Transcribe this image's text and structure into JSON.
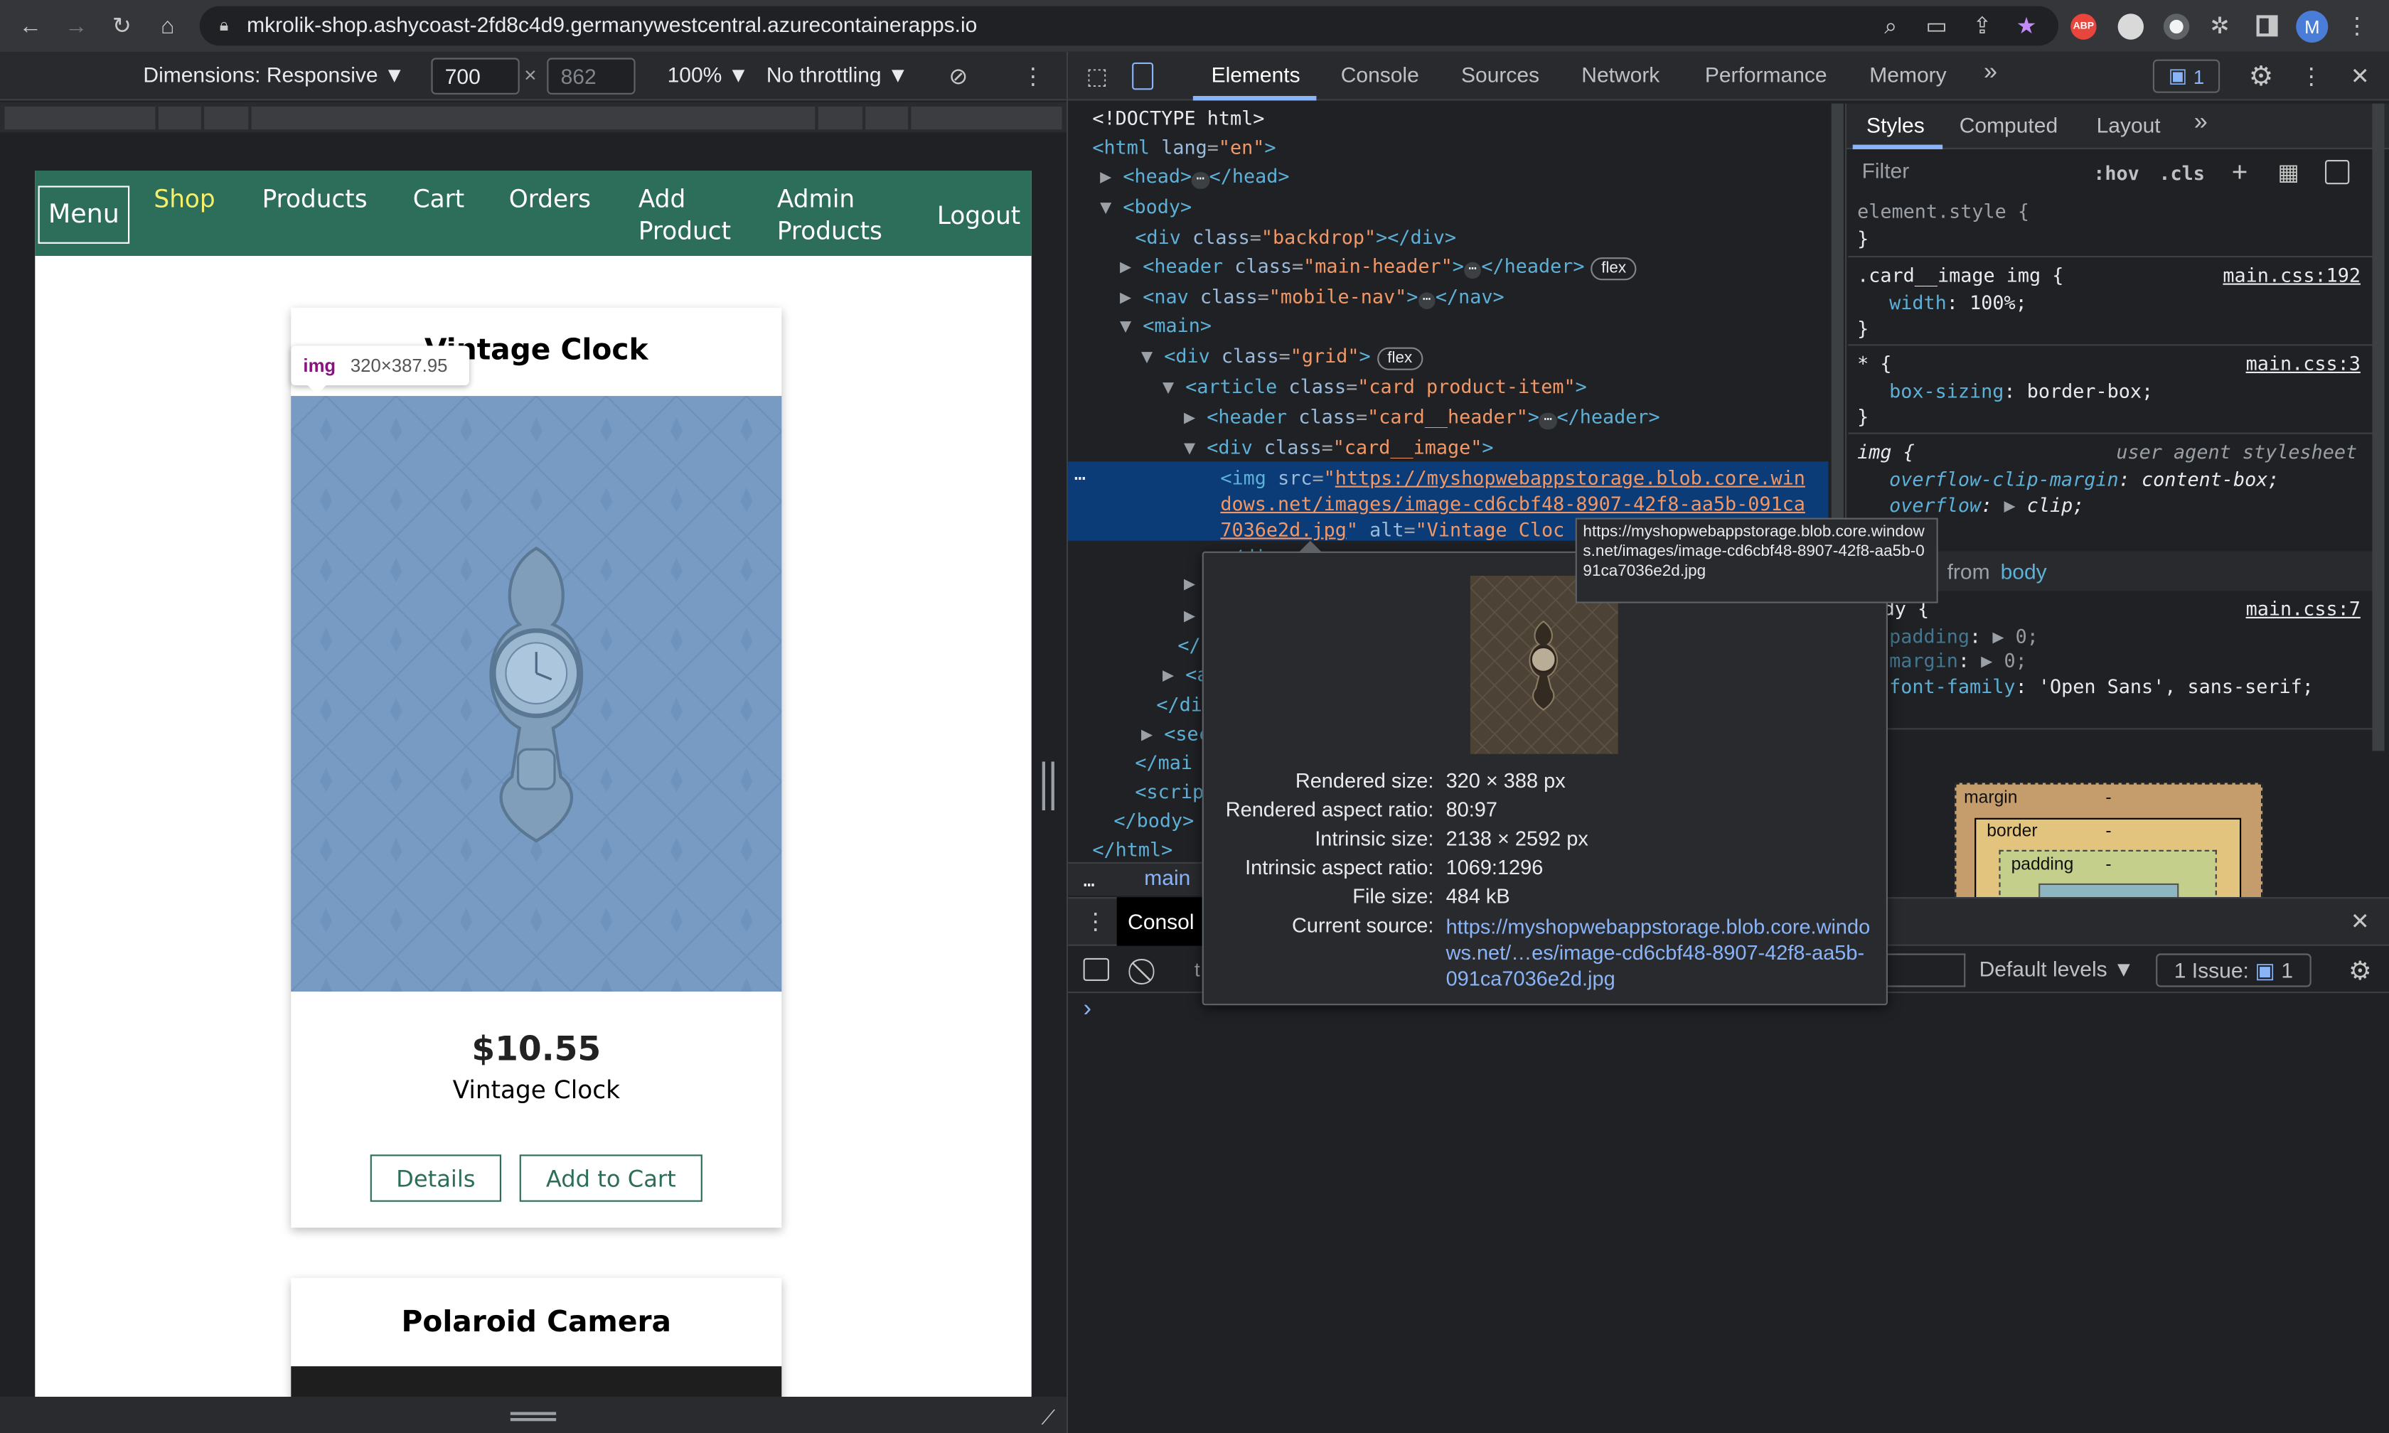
{
  "browser": {
    "url": "mkrolik-shop.ashycoast-2fd8c4d9.germanywestcentral.azurecontainerapps.io",
    "profile_initial": "M",
    "abp_label": "ABP"
  },
  "device_toolbar": {
    "dimensions_label": "Dimensions: Responsive",
    "width_value": "700",
    "height_placeholder": "862",
    "times": "×",
    "zoom": "100%",
    "throttling": "No throttling"
  },
  "shop": {
    "nav": {
      "menu": "Menu",
      "shop": "Shop",
      "products": "Products",
      "cart": "Cart",
      "orders": "Orders",
      "add_product_1": "Add",
      "add_product_2": "Product",
      "admin_products_1": "Admin",
      "admin_products_2": "Products",
      "logout": "Logout",
      "active_color": "#f6ef6b",
      "bar_color": "#2c6e5a"
    },
    "card1": {
      "title": "Vintage Clock",
      "price": "$10.55",
      "name": "Vintage Clock",
      "details_button": "Details",
      "add_to_cart_button": "Add to Cart"
    },
    "card2": {
      "title": "Polaroid Camera"
    },
    "img_tooltip": {
      "tag": "img",
      "size": "320×387.95"
    }
  },
  "devtools": {
    "tabs": [
      "Elements",
      "Console",
      "Sources",
      "Network",
      "Performance",
      "Memory"
    ],
    "more_tabs": "»",
    "issues_count": "1",
    "dom": {
      "doctype": "<!DOCTYPE html>",
      "html_open": "<html",
      "lang_attr": "lang",
      "lang_val": "\"en\"",
      "head": "<head>",
      "head_close": "</head>",
      "body_open": "<body>",
      "backdrop_div": "<div",
      "class_attr": "class",
      "backdrop_val": "\"backdrop\"",
      "div_close": "></div>",
      "header_tag": "<header",
      "main_header_val": "\"main-header\"",
      "header_close": "</header>",
      "flex": "flex",
      "nav_tag": "<nav",
      "mobile_nav_val": "\"mobile-nav\"",
      "nav_close": "</nav>",
      "main_open": "<main>",
      "grid_val": "\"grid\"",
      "article_tag": "<article",
      "article_val": "\"card product-item\"",
      "card_header_val": "\"card__header\"",
      "card_image_val": "\"card__image\"",
      "img_tag": "<img",
      "src_attr": "src",
      "src_line1": "https://myshopwebappstorage.blob.core.win",
      "src_line2": "dows.net/images/image-cd6cbf48-8907-42f8-aa5b-091ca",
      "src_line3": "7036e2d.jpg",
      "alt_attr": "alt",
      "alt_val": "\"Vintage Cloc",
      "div_end": "</div>",
      "a_frag": "<a",
      "di_frag": "</di",
      "sec_frag": "<sec",
      "main_frag": "</mai",
      "scri_frag": "<scrip",
      "body_close": "</body>",
      "html_close": "</html>",
      "close_frag": "</",
      "ellipsis": "…",
      "dots": "⋯"
    },
    "breadcrumb": "main",
    "styles": {
      "tabs": [
        "Styles",
        "Computed",
        "Layout"
      ],
      "filter_placeholder": "Filter",
      "hov": ":hov",
      "cls": ".cls",
      "rules": [
        {
          "selector": "element.style {",
          "close": "}"
        },
        {
          "selector": ".card__image img {",
          "source": "main.css:192",
          "prop": "width",
          "value": "100%;",
          "close": "}"
        },
        {
          "selector": "* {",
          "source": "main.css:3",
          "prop": "box-sizing",
          "value": "border-box;",
          "close": "}"
        },
        {
          "selector": "img {",
          "source": "user agent stylesheet",
          "prop": "overflow-clip-margin",
          "value": "content-box;",
          "prop2": "overflow",
          "value2": "clip;"
        }
      ],
      "inherited_from": "from",
      "inherited_tag": "body",
      "body_rule_frag": "dy {",
      "body_source": "main.css:7",
      "body_props": [
        {
          "prop": "padding",
          "value": "0;"
        },
        {
          "prop": "margin",
          "value": "0;"
        },
        {
          "prop": "font-family",
          "value": "'Open Sans', sans-serif;"
        }
      ],
      "box_model": {
        "margin": "margin",
        "border": "border",
        "padding": "padding",
        "dash": "-"
      }
    },
    "hover_card": {
      "rendered_size_label": "Rendered size:",
      "rendered_size": "320 × 388 px",
      "rendered_ratio_label": "Rendered aspect ratio:",
      "rendered_ratio": "80:97",
      "intrinsic_size_label": "Intrinsic size:",
      "intrinsic_size": "2138 × 2592 px",
      "intrinsic_ratio_label": "Intrinsic aspect ratio:",
      "intrinsic_ratio": "1069:1296",
      "file_size_label": "File size:",
      "file_size": "484 kB",
      "source_label": "Current source:",
      "source": "https://myshopwebappstorage.blob.core.windows.net/…es/image-cd6cbf48-8907-42f8-aa5b-091ca7036e2d.jpg"
    },
    "url_tooltip": "https://myshopwebappstorage.blob.core.windows.net/images/image-cd6cbf48-8907-42f8-aa5b-091ca7036e2d.jpg",
    "console": {
      "tab": "Consol",
      "filter_frag": "t",
      "levels": "Default levels",
      "issues_label": "1 Issue:",
      "issues_count": "1",
      "prompt": "›"
    }
  }
}
